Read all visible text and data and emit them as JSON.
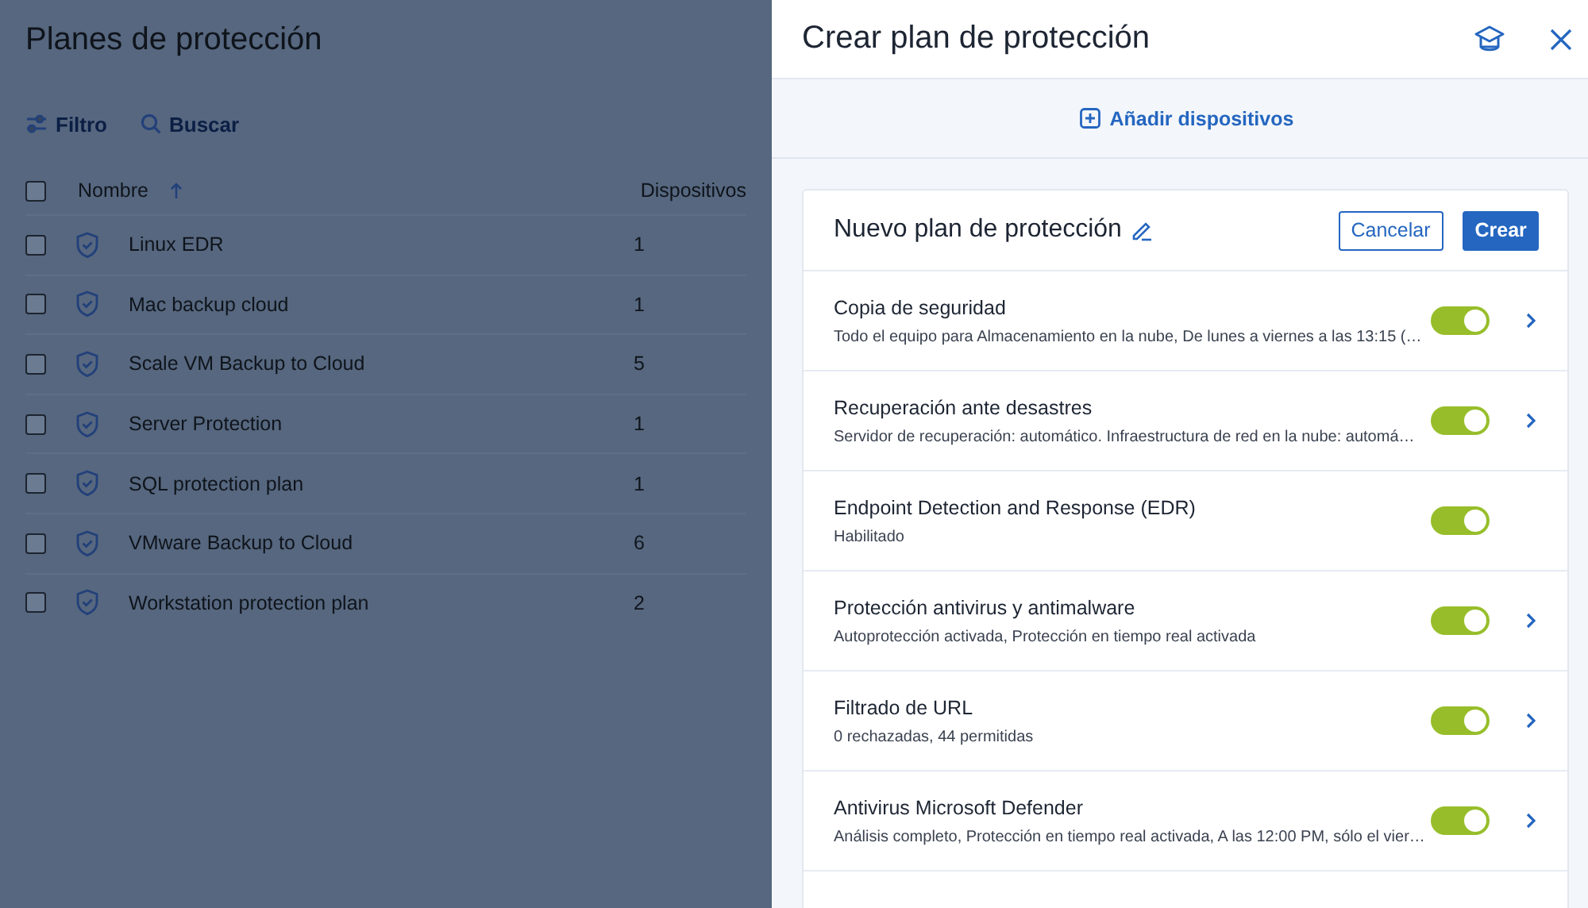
{
  "background": {
    "title": "Planes de protección",
    "toolbar": [
      {
        "kind": "filter",
        "label": "Filtro"
      },
      {
        "kind": "search",
        "label": "Buscar"
      }
    ],
    "table": {
      "columns": [
        "Nombre",
        "Dispositivos"
      ],
      "all_checked": false,
      "rows": [
        {
          "name": "Linux EDR",
          "devices": "1",
          "checked": false
        },
        {
          "name": "Mac backup cloud",
          "devices": "1",
          "checked": false
        },
        {
          "name": "Scale VM Backup to Cloud",
          "devices": "5",
          "checked": false
        },
        {
          "name": "Server Protection",
          "devices": "1",
          "checked": false
        },
        {
          "name": "SQL protection plan",
          "devices": "1",
          "checked": false
        },
        {
          "name": "VMware Backup to Cloud",
          "devices": "6",
          "checked": false
        },
        {
          "name": "Workstation protection plan",
          "devices": "2",
          "checked": false
        }
      ]
    }
  },
  "panel": {
    "title": "Crear plan de protección",
    "add_devices": "Añadir dispositivos",
    "plan_name": "Nuevo plan de protección",
    "buttons": [
      {
        "kind": "secondary",
        "label": "Cancelar"
      },
      {
        "kind": "primary",
        "label": "Crear"
      }
    ],
    "modules": [
      {
        "title": "Copia de seguridad",
        "description": "Todo el equipo para Almacenamiento en la nube, De lunes a viernes a las 13:15 (…",
        "on": true,
        "details": true
      },
      {
        "title": "Recuperación ante desastres",
        "description": "Servidor de recuperación: automático. Infraestructura de red en la nube: automá…",
        "on": true,
        "details": true
      },
      {
        "title": "Endpoint Detection and Response (EDR)",
        "description": "Habilitado",
        "on": true,
        "details": false
      },
      {
        "title": "Protección antivirus y antimalware",
        "description": "Autoprotección activada, Protección en tiempo real activada",
        "on": true,
        "details": true
      },
      {
        "title": "Filtrado de URL",
        "description": "0 rechazadas, 44 permitidas",
        "on": true,
        "details": true
      },
      {
        "title": "Antivirus Microsoft Defender",
        "description": "Análisis completo, Protección en tiempo real activada, A las 12:00 PM, sólo el vier…",
        "on": true,
        "details": true
      }
    ]
  }
}
